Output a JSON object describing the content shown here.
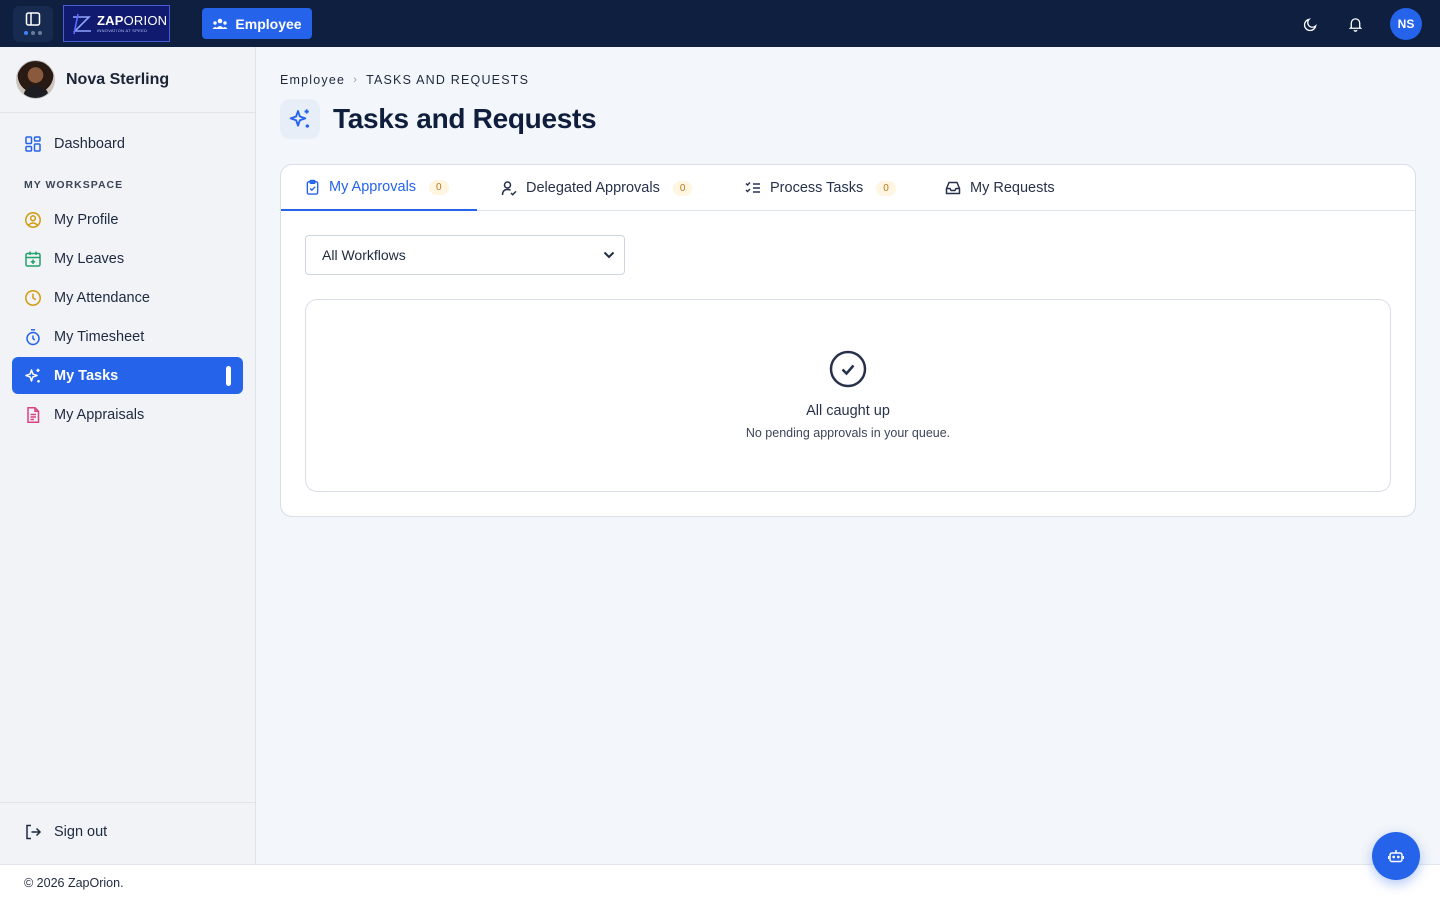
{
  "topbar": {
    "logo": {
      "name_bold": "ZAP",
      "name_rest": "ORION",
      "tagline": "INNOVATION AT SPEED"
    },
    "role_button": "Employee",
    "user_initials": "NS"
  },
  "sidebar": {
    "user_name": "Nova Sterling",
    "dashboard_label": "Dashboard",
    "section_label": "MY WORKSPACE",
    "items": [
      {
        "label": "My Profile",
        "icon": "user-circle-icon",
        "color": "#d29b0c"
      },
      {
        "label": "My Leaves",
        "icon": "calendar-plus-icon",
        "color": "#22a06b"
      },
      {
        "label": "My Attendance",
        "icon": "clock-icon",
        "color": "#d29b0c"
      },
      {
        "label": "My Timesheet",
        "icon": "stopwatch-icon",
        "color": "#2563eb"
      },
      {
        "label": "My Tasks",
        "icon": "sparkles-icon",
        "color": "#ffffff",
        "active": true
      },
      {
        "label": "My Appraisals",
        "icon": "document-icon",
        "color": "#d94383"
      }
    ],
    "signout_label": "Sign out"
  },
  "breadcrumb": {
    "root": "Employee",
    "current": "TASKS AND REQUESTS"
  },
  "page_title": "Tasks and Requests",
  "tabs": [
    {
      "label": "My Approvals",
      "count": "0",
      "icon": "clipboard-check-icon",
      "active": true
    },
    {
      "label": "Delegated Approvals",
      "count": "0",
      "icon": "user-check-icon"
    },
    {
      "label": "Process Tasks",
      "count": "0",
      "icon": "list-checks-icon"
    },
    {
      "label": "My Requests",
      "icon": "inbox-icon"
    }
  ],
  "workflow_filter": {
    "selected": "All Workflows"
  },
  "empty_state": {
    "title": "All caught up",
    "subtitle": "No pending approvals in your queue."
  },
  "footer": "© 2026 ZapOrion.",
  "colors": {
    "topbar": "#0e1f3f",
    "accent": "#2563eb",
    "badge_text": "#b7791f"
  }
}
